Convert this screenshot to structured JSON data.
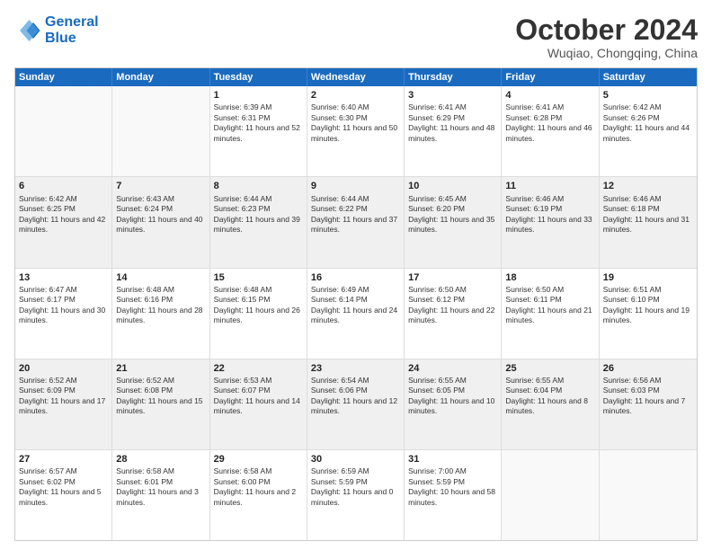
{
  "header": {
    "logo_line1": "General",
    "logo_line2": "Blue",
    "month": "October 2024",
    "location": "Wuqiao, Chongqing, China"
  },
  "days_of_week": [
    "Sunday",
    "Monday",
    "Tuesday",
    "Wednesday",
    "Thursday",
    "Friday",
    "Saturday"
  ],
  "weeks": [
    [
      {
        "day": "",
        "empty": true
      },
      {
        "day": "",
        "empty": true
      },
      {
        "day": "1",
        "sunrise": "6:39 AM",
        "sunset": "6:31 PM",
        "daylight": "11 hours and 52 minutes."
      },
      {
        "day": "2",
        "sunrise": "6:40 AM",
        "sunset": "6:30 PM",
        "daylight": "11 hours and 50 minutes."
      },
      {
        "day": "3",
        "sunrise": "6:41 AM",
        "sunset": "6:29 PM",
        "daylight": "11 hours and 48 minutes."
      },
      {
        "day": "4",
        "sunrise": "6:41 AM",
        "sunset": "6:28 PM",
        "daylight": "11 hours and 46 minutes."
      },
      {
        "day": "5",
        "sunrise": "6:42 AM",
        "sunset": "6:26 PM",
        "daylight": "11 hours and 44 minutes."
      }
    ],
    [
      {
        "day": "6",
        "sunrise": "6:42 AM",
        "sunset": "6:25 PM",
        "daylight": "11 hours and 42 minutes."
      },
      {
        "day": "7",
        "sunrise": "6:43 AM",
        "sunset": "6:24 PM",
        "daylight": "11 hours and 40 minutes."
      },
      {
        "day": "8",
        "sunrise": "6:44 AM",
        "sunset": "6:23 PM",
        "daylight": "11 hours and 39 minutes."
      },
      {
        "day": "9",
        "sunrise": "6:44 AM",
        "sunset": "6:22 PM",
        "daylight": "11 hours and 37 minutes."
      },
      {
        "day": "10",
        "sunrise": "6:45 AM",
        "sunset": "6:20 PM",
        "daylight": "11 hours and 35 minutes."
      },
      {
        "day": "11",
        "sunrise": "6:46 AM",
        "sunset": "6:19 PM",
        "daylight": "11 hours and 33 minutes."
      },
      {
        "day": "12",
        "sunrise": "6:46 AM",
        "sunset": "6:18 PM",
        "daylight": "11 hours and 31 minutes."
      }
    ],
    [
      {
        "day": "13",
        "sunrise": "6:47 AM",
        "sunset": "6:17 PM",
        "daylight": "11 hours and 30 minutes."
      },
      {
        "day": "14",
        "sunrise": "6:48 AM",
        "sunset": "6:16 PM",
        "daylight": "11 hours and 28 minutes."
      },
      {
        "day": "15",
        "sunrise": "6:48 AM",
        "sunset": "6:15 PM",
        "daylight": "11 hours and 26 minutes."
      },
      {
        "day": "16",
        "sunrise": "6:49 AM",
        "sunset": "6:14 PM",
        "daylight": "11 hours and 24 minutes."
      },
      {
        "day": "17",
        "sunrise": "6:50 AM",
        "sunset": "6:12 PM",
        "daylight": "11 hours and 22 minutes."
      },
      {
        "day": "18",
        "sunrise": "6:50 AM",
        "sunset": "6:11 PM",
        "daylight": "11 hours and 21 minutes."
      },
      {
        "day": "19",
        "sunrise": "6:51 AM",
        "sunset": "6:10 PM",
        "daylight": "11 hours and 19 minutes."
      }
    ],
    [
      {
        "day": "20",
        "sunrise": "6:52 AM",
        "sunset": "6:09 PM",
        "daylight": "11 hours and 17 minutes."
      },
      {
        "day": "21",
        "sunrise": "6:52 AM",
        "sunset": "6:08 PM",
        "daylight": "11 hours and 15 minutes."
      },
      {
        "day": "22",
        "sunrise": "6:53 AM",
        "sunset": "6:07 PM",
        "daylight": "11 hours and 14 minutes."
      },
      {
        "day": "23",
        "sunrise": "6:54 AM",
        "sunset": "6:06 PM",
        "daylight": "11 hours and 12 minutes."
      },
      {
        "day": "24",
        "sunrise": "6:55 AM",
        "sunset": "6:05 PM",
        "daylight": "11 hours and 10 minutes."
      },
      {
        "day": "25",
        "sunrise": "6:55 AM",
        "sunset": "6:04 PM",
        "daylight": "11 hours and 8 minutes."
      },
      {
        "day": "26",
        "sunrise": "6:56 AM",
        "sunset": "6:03 PM",
        "daylight": "11 hours and 7 minutes."
      }
    ],
    [
      {
        "day": "27",
        "sunrise": "6:57 AM",
        "sunset": "6:02 PM",
        "daylight": "11 hours and 5 minutes."
      },
      {
        "day": "28",
        "sunrise": "6:58 AM",
        "sunset": "6:01 PM",
        "daylight": "11 hours and 3 minutes."
      },
      {
        "day": "29",
        "sunrise": "6:58 AM",
        "sunset": "6:00 PM",
        "daylight": "11 hours and 2 minutes."
      },
      {
        "day": "30",
        "sunrise": "6:59 AM",
        "sunset": "5:59 PM",
        "daylight": "11 hours and 0 minutes."
      },
      {
        "day": "31",
        "sunrise": "7:00 AM",
        "sunset": "5:59 PM",
        "daylight": "10 hours and 58 minutes."
      },
      {
        "day": "",
        "empty": true
      },
      {
        "day": "",
        "empty": true
      }
    ]
  ]
}
